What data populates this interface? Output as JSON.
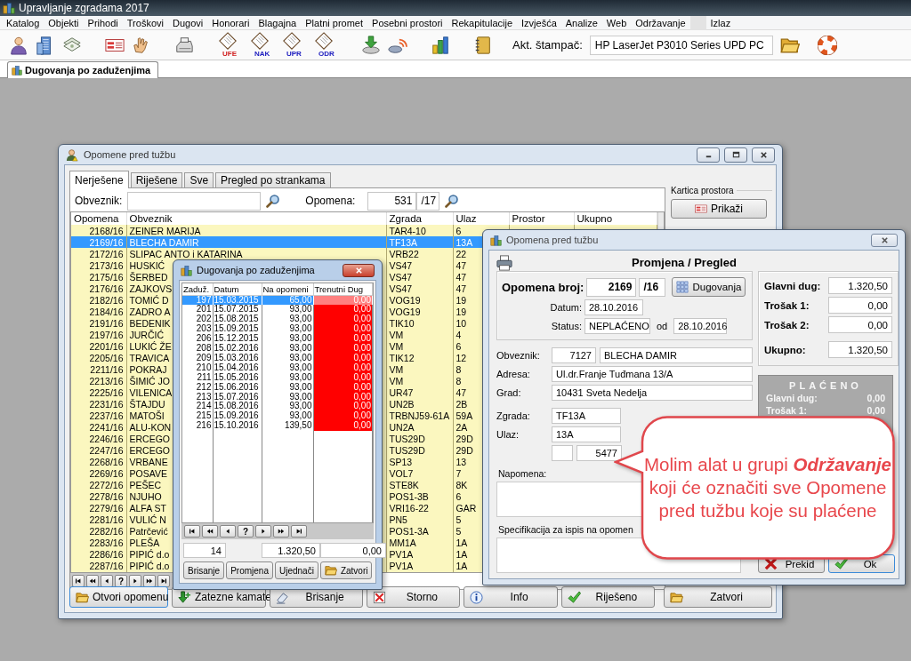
{
  "app": {
    "title": "Upravljanje zgradama 2017",
    "menu": [
      "Katalog",
      "Objekti",
      "Prihodi",
      "Troškovi",
      "Dugovi",
      "Honorari",
      "Blagajna",
      "Platni promet",
      "Posebni prostori",
      "Rekapitulacije",
      "Izvješća",
      "Analize",
      "Web",
      "Održavanje",
      "Izlaz"
    ],
    "doc_labels": [
      "UFE",
      "NAK",
      "UPR",
      "ODR"
    ],
    "printer": {
      "label": "Akt. štampač:",
      "value": "HP LaserJet P3010 Series UPD PC"
    },
    "tabs": [
      {
        "label": "Dugovanja po zaduženjima",
        "selected": true
      }
    ]
  },
  "main_window": {
    "title": "Opomene pred tužbu",
    "tabs": [
      {
        "label": "Nerješene",
        "selected": true
      },
      {
        "label": "Riješene",
        "selected": false
      },
      {
        "label": "Sve",
        "selected": false
      },
      {
        "label": "Pregled po strankama",
        "selected": false
      }
    ],
    "filter": {
      "obveznik_label": "Obveznik:",
      "opomena_label": "Opomena:",
      "opomena_number": "531",
      "opomena_year": "/17"
    },
    "kartica": {
      "label": "Kartica prostora",
      "button": "Prikaži"
    },
    "table": {
      "columns": [
        "Opomena",
        "Obveznik",
        "Zgrada",
        "Ulaz",
        "Prostor",
        "Ukupno"
      ],
      "rows": [
        {
          "cells": [
            "2168/16",
            "ZEINER MARIJA",
            "TAR4-10",
            "6"
          ],
          "selected": false
        },
        {
          "cells": [
            "2169/16",
            "BLECHA DAMIR",
            "TF13A",
            "13A"
          ],
          "selected": true
        },
        {
          "cells": [
            "2172/16",
            "SLIPAC ANTO i KATARINA",
            "VRB22",
            "22"
          ],
          "selected": false
        },
        {
          "cells": [
            "2173/16",
            "HUSKIĆ",
            "VS47",
            "47"
          ],
          "selected": false
        },
        {
          "cells": [
            "2175/16",
            "ŠERBED",
            "VS47",
            "47"
          ],
          "selected": false
        },
        {
          "cells": [
            "2176/16",
            "ZAJKOVS",
            "VS47",
            "47"
          ],
          "selected": false
        },
        {
          "cells": [
            "2182/16",
            "TOMIĆ D",
            "VOG19",
            "19"
          ],
          "selected": false
        },
        {
          "cells": [
            "2184/16",
            "ZADRO A",
            "VOG19",
            "19"
          ],
          "selected": false
        },
        {
          "cells": [
            "2191/16",
            "BEDENIK",
            "TIK10",
            "10"
          ],
          "selected": false
        },
        {
          "cells": [
            "2197/16",
            "JURČIĆ",
            "VM",
            "4"
          ],
          "selected": false
        },
        {
          "cells": [
            "2201/16",
            "LUKIĆ ŽE",
            "VM",
            "6"
          ],
          "selected": false
        },
        {
          "cells": [
            "2205/16",
            "TRAVICA",
            "TIK12",
            "12"
          ],
          "selected": false
        },
        {
          "cells": [
            "2211/16",
            "POKRAJ",
            "VM",
            "8"
          ],
          "selected": false
        },
        {
          "cells": [
            "2213/16",
            "ŠIMIĆ JO",
            "VM",
            "8"
          ],
          "selected": false
        },
        {
          "cells": [
            "2225/16",
            "VILENICA",
            "UR47",
            "47"
          ],
          "selected": false
        },
        {
          "cells": [
            "2231/16",
            "ŠTAJDU",
            "UN2B",
            "2B"
          ],
          "selected": false
        },
        {
          "cells": [
            "2237/16",
            "MATOŠI",
            "TRBNJ59-61A",
            "59A"
          ],
          "selected": false
        },
        {
          "cells": [
            "2241/16",
            "ALU-KON",
            "UN2A",
            "2A"
          ],
          "selected": false
        },
        {
          "cells": [
            "2246/16",
            "ERCEGO",
            "TUS29D",
            "29D"
          ],
          "selected": false
        },
        {
          "cells": [
            "2247/16",
            "ERCEGO",
            "TUS29D",
            "29D"
          ],
          "selected": false
        },
        {
          "cells": [
            "2268/16",
            "VRBANE",
            "SP13",
            "13"
          ],
          "selected": false
        },
        {
          "cells": [
            "2269/16",
            "POSAVE",
            "VOL7",
            "7"
          ],
          "selected": false
        },
        {
          "cells": [
            "2272/16",
            "PEŠEC",
            "STE8K",
            "8K"
          ],
          "selected": false
        },
        {
          "cells": [
            "2278/16",
            "NJUHO",
            "POS1-3B",
            "6"
          ],
          "selected": false
        },
        {
          "cells": [
            "2279/16",
            "ALFA ST",
            "VRI16-22",
            "GAR"
          ],
          "selected": false
        },
        {
          "cells": [
            "2281/16",
            "VULIĆ N",
            "PN5",
            "5"
          ],
          "selected": false
        },
        {
          "cells": [
            "2282/16",
            "Patrčević",
            "POS1-3A",
            "5"
          ],
          "selected": false
        },
        {
          "cells": [
            "2283/16",
            "PLEŠA",
            "MM1A",
            "1A"
          ],
          "selected": false
        },
        {
          "cells": [
            "2286/16",
            "PIPIĆ d.o",
            "PV1A",
            "1A"
          ],
          "selected": false
        },
        {
          "cells": [
            "2287/16",
            "PIPIĆ d.o",
            "PV1A",
            "1A"
          ],
          "selected": false
        }
      ]
    },
    "nav": "?",
    "buttons": [
      {
        "label": "Otvori opomenu",
        "kind": "open"
      },
      {
        "label": "Zatezne kamate",
        "kind": "interest"
      },
      {
        "label": "Brisanje",
        "kind": "erase"
      },
      {
        "label": "Storno",
        "kind": "cancel"
      },
      {
        "label": "Info",
        "kind": "info"
      },
      {
        "label": "Riješeno",
        "kind": "resolve"
      },
      {
        "label": "Zatvori",
        "kind": "close"
      }
    ]
  },
  "debt_window": {
    "title": "Dugovanja po zaduženjima",
    "table": {
      "columns": [
        "Zaduž.",
        "Datum",
        "Na opomeni",
        "Trenutni Dug"
      ],
      "rows": [
        {
          "cells": [
            "197",
            "15.03.2015",
            "65,00",
            "0,00"
          ],
          "selected": true
        },
        {
          "cells": [
            "201",
            "15.07.2015",
            "93,00",
            "0,00"
          ],
          "selected": false
        },
        {
          "cells": [
            "202",
            "15.08.2015",
            "93,00",
            "0,00"
          ],
          "selected": false
        },
        {
          "cells": [
            "203",
            "15.09.2015",
            "93,00",
            "0,00"
          ],
          "selected": false
        },
        {
          "cells": [
            "206",
            "15.12.2015",
            "93,00",
            "0,00"
          ],
          "selected": false
        },
        {
          "cells": [
            "208",
            "15.02.2016",
            "93,00",
            "0,00"
          ],
          "selected": false
        },
        {
          "cells": [
            "209",
            "15.03.2016",
            "93,00",
            "0,00"
          ],
          "selected": false
        },
        {
          "cells": [
            "210",
            "15.04.2016",
            "93,00",
            "0,00"
          ],
          "selected": false
        },
        {
          "cells": [
            "211",
            "15.05.2016",
            "93,00",
            "0,00"
          ],
          "selected": false
        },
        {
          "cells": [
            "212",
            "15.06.2016",
            "93,00",
            "0,00"
          ],
          "selected": false
        },
        {
          "cells": [
            "213",
            "15.07.2016",
            "93,00",
            "0,00"
          ],
          "selected": false
        },
        {
          "cells": [
            "214",
            "15.08.2016",
            "93,00",
            "0,00"
          ],
          "selected": false
        },
        {
          "cells": [
            "215",
            "15.09.2016",
            "93,00",
            "0,00"
          ],
          "selected": false
        },
        {
          "cells": [
            "216",
            "15.10.2016",
            "139,50",
            "0,00"
          ],
          "selected": false
        }
      ]
    },
    "nav": "?",
    "totals": [
      "14",
      "1.320,50",
      "0,00"
    ],
    "buttons": [
      {
        "label": "Brisanje",
        "kind": "plain"
      },
      {
        "label": "Promjena",
        "kind": "plain"
      },
      {
        "label": "Ujednači",
        "kind": "plain"
      },
      {
        "label": "Zatvori",
        "kind": "close"
      }
    ]
  },
  "dialog": {
    "title": "Opomena pred tužbu",
    "heading": "Promjena / Pregled",
    "number_label": "Opomena broj:",
    "number": "2169",
    "year": "/16",
    "debts_button": "Dugovanja",
    "date_label": "Datum:",
    "date": "28.10.2016",
    "status_label": "Status:",
    "status": "NEPLAĆENO",
    "since_label": "od",
    "since": "28.10.2016",
    "amounts": [
      {
        "label": "Glavni dug:",
        "value": "1.320,50"
      },
      {
        "label": "Trošak 1:",
        "value": "0,00"
      },
      {
        "label": "Trošak 2:",
        "value": "0,00"
      },
      {
        "label": "Ukupno:",
        "value": "1.320,50"
      }
    ],
    "paid": {
      "title": "PLAĆENO",
      "rows": [
        {
          "label": "Glavni dug:",
          "value": "0,00"
        },
        {
          "label": "Trošak 1:",
          "value": "0,00"
        }
      ]
    },
    "party": [
      {
        "label": "Obveznik:",
        "values": [
          "7127",
          "BLECHA DAMIR"
        ]
      },
      {
        "label": "Adresa:",
        "values": [
          "Ul.dr.Franje Tuđmana 13/A"
        ]
      },
      {
        "label": "Grad:",
        "values": [
          "10431 Sveta Nedelja"
        ]
      }
    ],
    "building": [
      {
        "label": "Zgrada:",
        "values": [
          "TF13A"
        ]
      },
      {
        "label": "Ulaz:",
        "values": [
          "13A"
        ]
      }
    ],
    "unit": "5477",
    "notes": [
      "Napomena:",
      "Specifikacija za ispis na opomen"
    ],
    "buttons": [
      {
        "label": "Prekid",
        "kind": "cancel"
      },
      {
        "label": "Ok",
        "kind": "ok"
      }
    ]
  },
  "callout": {
    "text": "Molim alat u grupi **Održavanje** koji će označiti sve Opomene pred tužbu koje su plaćene"
  }
}
